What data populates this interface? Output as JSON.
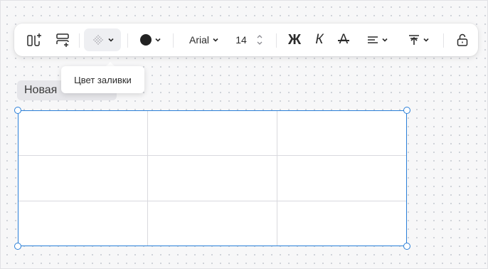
{
  "toolbar": {
    "font_family": "Arial",
    "font_size": "14",
    "bold_label": "Ж",
    "italic_label": "К",
    "strikethrough_label": "А",
    "text_color": "#222222",
    "icons": {
      "add_column": "add-column-icon",
      "add_row": "add-row-icon",
      "fill": "fill-pattern-icon",
      "color": "color-dot-icon",
      "size_stepper": "stepper-icon",
      "align": "align-icon",
      "valign": "vertical-align-top-icon",
      "lock": "unlock-icon"
    }
  },
  "tooltip": {
    "text": "Цвет заливки"
  },
  "table": {
    "title_visible": "Новая",
    "rows": [
      [
        "",
        "",
        ""
      ],
      [
        "",
        "",
        ""
      ],
      [
        "",
        "",
        ""
      ]
    ]
  },
  "colors": {
    "selection": "#2a7fd8",
    "canvas": "#f7f7f8"
  }
}
